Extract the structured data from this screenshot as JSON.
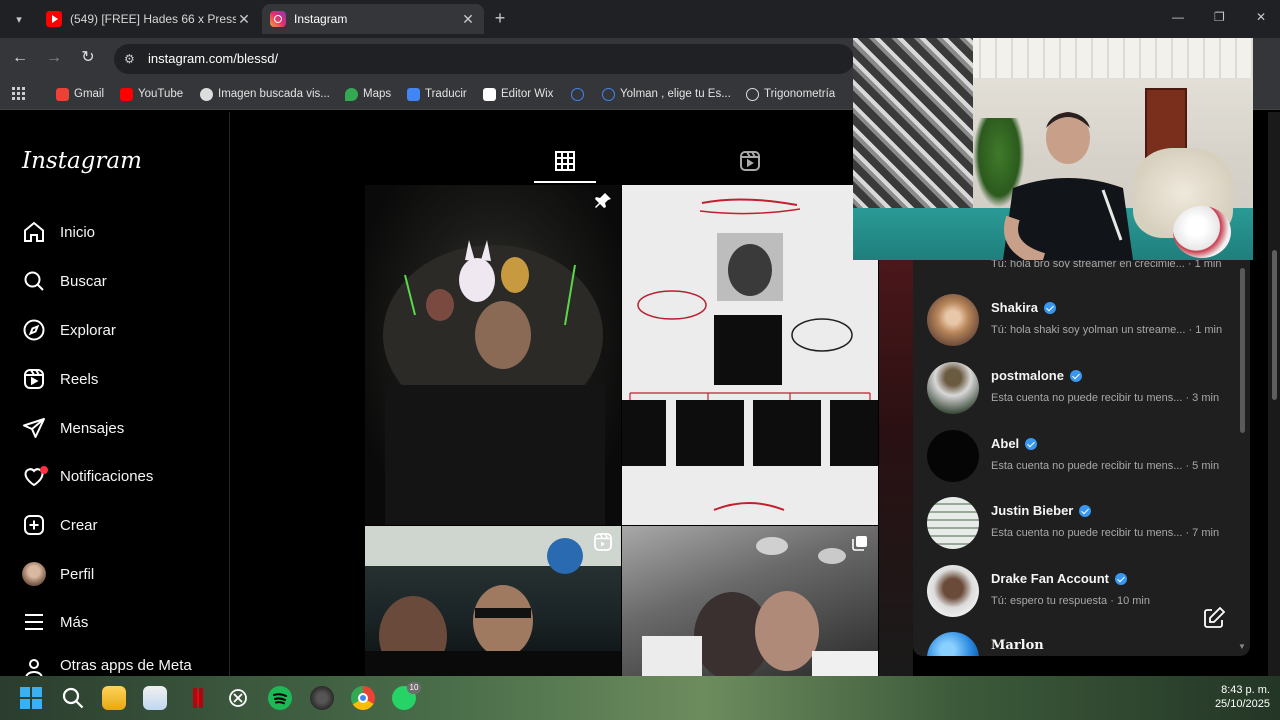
{
  "browser": {
    "tabs": [
      {
        "title": "(549) [FREE] Hades 66 x Pressur",
        "icon": "youtube-icon",
        "active": false
      },
      {
        "title": "Instagram",
        "icon": "instagram-icon",
        "active": true
      }
    ],
    "url": "instagram.com/blessd/",
    "bookmarks": [
      {
        "label": "Gmail",
        "icon": "gmail-icon",
        "color": "#ea4335"
      },
      {
        "label": "YouTube",
        "icon": "youtube-icon",
        "color": "#ff0000"
      },
      {
        "label": "Imagen buscada vis...",
        "icon": "google-lens-icon",
        "color": "#dddddd"
      },
      {
        "label": "Maps",
        "icon": "maps-icon",
        "color": "#34a853"
      },
      {
        "label": "Traducir",
        "icon": "translate-icon",
        "color": "#4285f4"
      },
      {
        "label": "Editor Wix",
        "icon": "wix-icon",
        "color": "#ffffff"
      },
      {
        "label": "",
        "icon": "globe-icon",
        "color": "#4285f4"
      },
      {
        "label": "Yolman , elige tu Es...",
        "icon": "globe-icon",
        "color": "#4285f4"
      },
      {
        "label": "Trigonometría",
        "icon": "globe-icon",
        "color": "#dddddd"
      }
    ]
  },
  "sidebar": {
    "logo": "Instagram",
    "items": [
      {
        "label": "Inicio",
        "icon": "home-icon"
      },
      {
        "label": "Buscar",
        "icon": "search-icon"
      },
      {
        "label": "Explorar",
        "icon": "compass-icon"
      },
      {
        "label": "Reels",
        "icon": "reels-icon"
      },
      {
        "label": "Mensajes",
        "icon": "send-icon"
      },
      {
        "label": "Notificaciones",
        "icon": "heart-icon"
      },
      {
        "label": "Crear",
        "icon": "plus-square-icon"
      },
      {
        "label": "Perfil",
        "icon": "avatar-icon"
      },
      {
        "label": "Más",
        "icon": "menu-icon"
      },
      {
        "label": "Otras apps de Meta",
        "icon": "meta-apps-icon"
      }
    ]
  },
  "profile_tabs": [
    {
      "name": "posts",
      "icon": "grid-icon",
      "active": true
    },
    {
      "name": "reels",
      "icon": "reels-icon",
      "active": false
    }
  ],
  "messages": {
    "partial_first_preview": "Tú: hola bro soy streamer en crecimie... · 1 min",
    "conversations": [
      {
        "name": "Shakira",
        "verified": true,
        "preview": "Tú: hola shaki soy yolman un streame... · 1 min"
      },
      {
        "name": "postmalone",
        "verified": true,
        "preview": "Esta cuenta no puede recibir tu mens... · 3 min"
      },
      {
        "name": "Abel",
        "verified": true,
        "preview": "Esta cuenta no puede recibir tu mens... · 5 min"
      },
      {
        "name": "Justin Bieber",
        "verified": true,
        "preview": "Esta cuenta no puede recibir tu mens... · 7 min"
      },
      {
        "name": "Drake Fan Account",
        "verified": true,
        "preview": "Tú: espero tu respuesta · 10 min"
      },
      {
        "name": "Marlon",
        "verified": false,
        "preview": ""
      }
    ]
  },
  "taskbar": {
    "time": "8:43 p. m.",
    "date": "25/10/2025",
    "whatsapp_badge": "10"
  },
  "colors": {
    "accent_verified": "#3897f0",
    "notif_dot": "#ff3040",
    "panel_bg": "#1f1f1f"
  }
}
